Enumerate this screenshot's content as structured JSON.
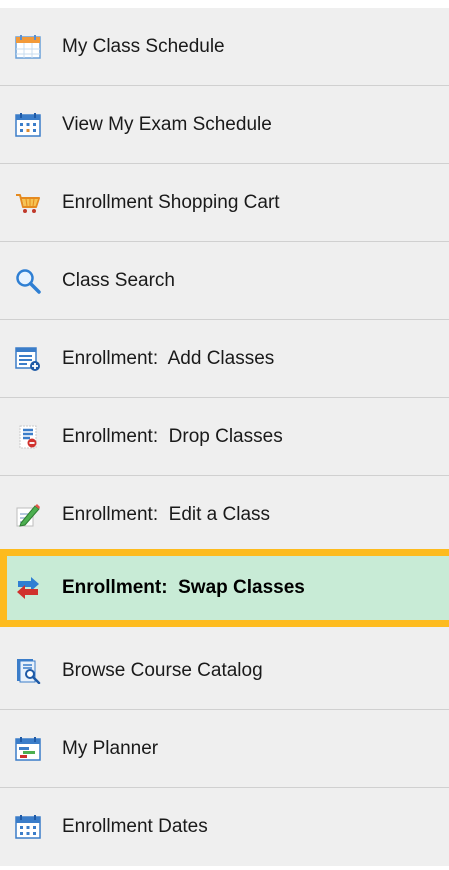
{
  "menu": {
    "items": [
      {
        "label": "My Class Schedule",
        "icon": "calendar-icon"
      },
      {
        "label": "View My Exam Schedule",
        "icon": "exam-calendar-icon"
      },
      {
        "label": "Enrollment Shopping Cart",
        "icon": "shopping-cart-icon"
      },
      {
        "label": "Class Search",
        "icon": "search-icon"
      },
      {
        "label": "Enrollment:  Add Classes",
        "icon": "add-list-icon"
      },
      {
        "label": "Enrollment:  Drop Classes",
        "icon": "drop-list-icon"
      },
      {
        "label": "Enrollment:  Edit a Class",
        "icon": "edit-pencil-icon"
      },
      {
        "label": "Enrollment:  Swap Classes",
        "icon": "swap-arrows-icon",
        "selected": true
      },
      {
        "label": "Browse Course Catalog",
        "icon": "catalog-icon"
      },
      {
        "label": "My Planner",
        "icon": "planner-icon"
      },
      {
        "label": "Enrollment Dates",
        "icon": "dates-calendar-icon"
      }
    ]
  },
  "colors": {
    "menu_background": "#efefef",
    "selected_background": "#c8ebd6",
    "selected_border": "#fdbb1e"
  }
}
